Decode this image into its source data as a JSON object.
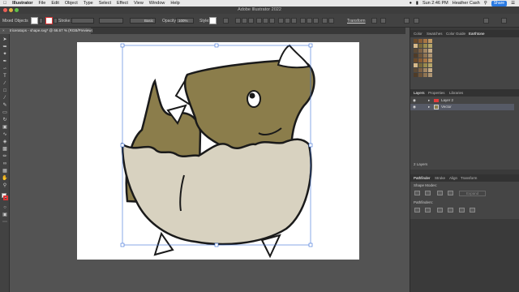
{
  "menubar": {
    "app_name": "Illustrator",
    "items": [
      "File",
      "Edit",
      "Object",
      "Type",
      "Select",
      "Effect",
      "View",
      "Window",
      "Help"
    ],
    "clock": "Sun 2:46 PM",
    "user": "Heather Cash",
    "share_label": "Share"
  },
  "window": {
    "title": "Adobe Illustrator 2022"
  },
  "control_bar": {
    "selection_label": "Mixed Objects",
    "stroke_label": "Stroke:",
    "brush_label": "Basic",
    "opacity_label": "Opacity:",
    "opacity_value": "100%",
    "style_label": "Style:",
    "transform_label": "Transform"
  },
  "document": {
    "tab_title": "triceratops - shape.svg* @ 66.67 % (RGB/Preview)"
  },
  "panels": {
    "top_tabs": [
      "Color",
      "Swatches",
      "Color Guide",
      "Earthtone"
    ],
    "top_active": "Earthtone",
    "mid_tabs": [
      "Layers",
      "Properties",
      "Libraries"
    ],
    "mid_active": "Layers",
    "layers": [
      {
        "name": "Layer 2"
      },
      {
        "name": "Vector"
      }
    ],
    "layers_count": "2 Layers",
    "bottom_tabs": [
      "Pathfinder",
      "Stroke",
      "Align",
      "Transform"
    ],
    "bottom_active": "Pathfinder",
    "shape_modes_label": "Shape Modes:",
    "expand_label": "Expand",
    "pathfinders_label": "Pathfinders:"
  },
  "colors": {
    "dino_body": "#8b7d4b",
    "egg_shell": "#d8d2c0",
    "outline": "#1a1a1a",
    "accent": "#2a7ae2",
    "selection": "#3a6fd8"
  }
}
